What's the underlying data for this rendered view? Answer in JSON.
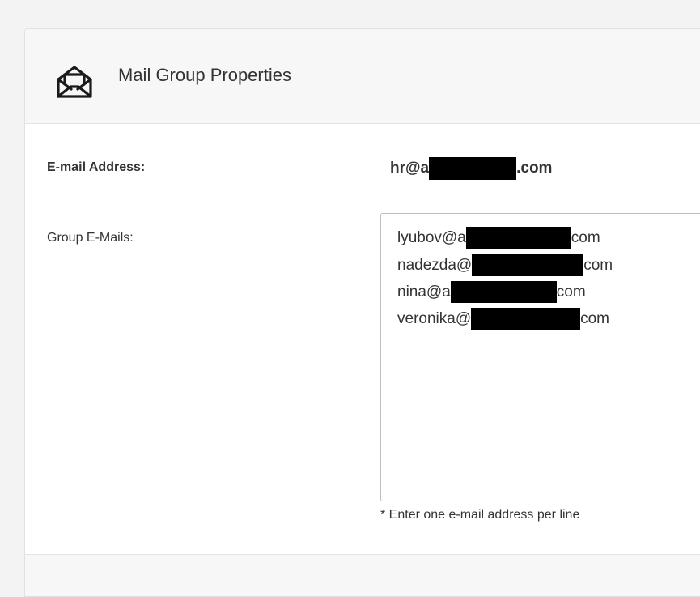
{
  "panel": {
    "title": "Mail Group Properties",
    "icon": "envelope-open-icon"
  },
  "fields": {
    "email_address_label": "E-mail Address:",
    "email_address_prefix": "hr@a",
    "email_address_suffix": ".com",
    "group_emails_label": "Group E-Mails:",
    "group_emails": [
      {
        "prefix": "lyubov@a",
        "suffix": "com"
      },
      {
        "prefix": "nadezda@",
        "suffix": "com"
      },
      {
        "prefix": "nina@a",
        "suffix": "com"
      },
      {
        "prefix": "veronika@",
        "suffix": "com"
      }
    ],
    "hint": "* Enter one e-mail address per line"
  },
  "colors": {
    "background": "#f3f3f3",
    "panel": "#ffffff",
    "header": "#f7f7f7",
    "redaction": "#000000"
  }
}
